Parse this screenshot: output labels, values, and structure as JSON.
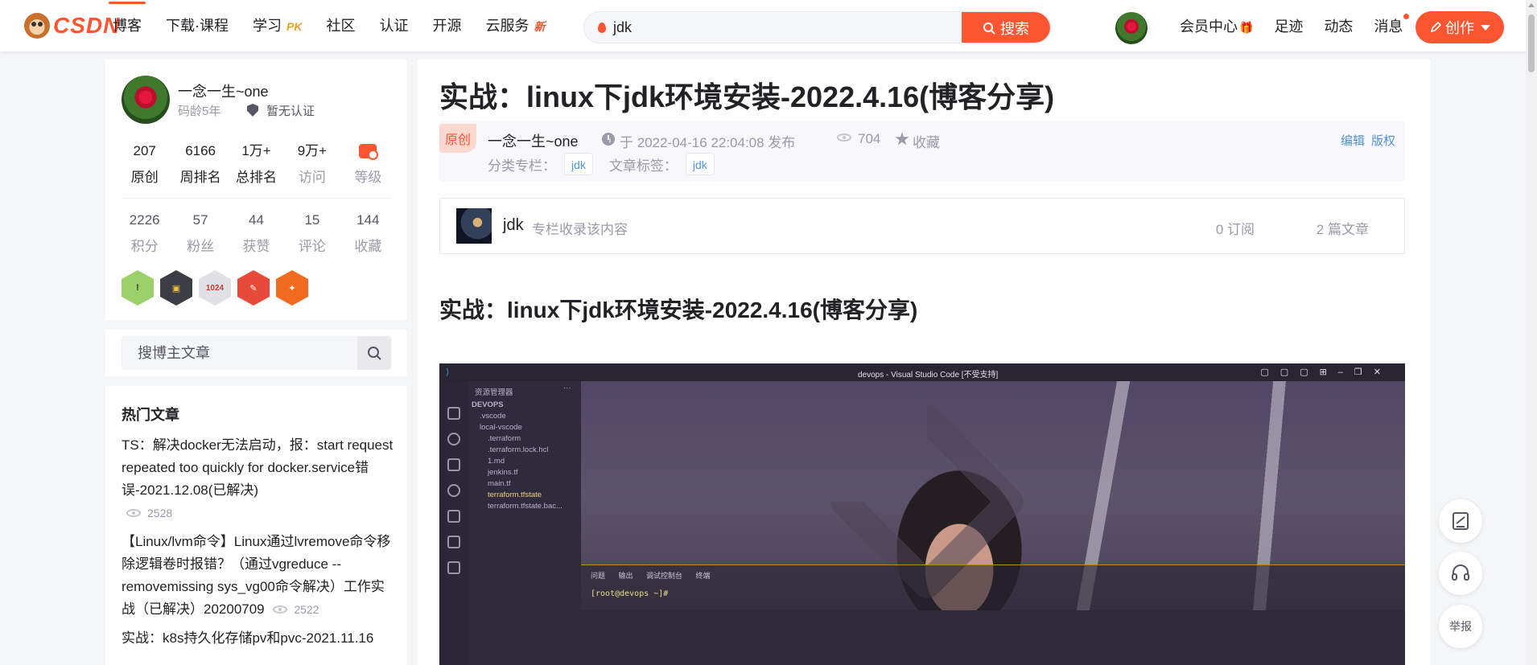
{
  "topnav": {
    "logo_text": "CSDN",
    "items": [
      {
        "label": "博客",
        "active": true,
        "badge": ""
      },
      {
        "label": "下载·课程",
        "active": false,
        "badge": ""
      },
      {
        "label": "学习",
        "active": false,
        "badge": "PK"
      },
      {
        "label": "社区",
        "active": false,
        "badge": ""
      },
      {
        "label": "认证",
        "active": false,
        "badge": ""
      },
      {
        "label": "开源",
        "active": false,
        "badge": ""
      },
      {
        "label": "云服务",
        "active": false,
        "badge": "新"
      }
    ],
    "search_query": "jdk",
    "search_button": "搜索",
    "right_links": {
      "member": "会员中心",
      "footprint": "足迹",
      "dynamics": "动态",
      "messages": "消息"
    },
    "create_button": "创作",
    "accent_color": "#fc5531"
  },
  "profile": {
    "name": "一念一生~one",
    "age": "码龄5年",
    "cert": "暂无认证",
    "stats_row1": [
      {
        "value": "207",
        "label": "原创"
      },
      {
        "value": "6166",
        "label": "周排名"
      },
      {
        "value": "1万+",
        "label": "总排名"
      },
      {
        "value": "9万+",
        "label": "访问"
      },
      {
        "value": "",
        "label": "等级"
      }
    ],
    "stats_row2": [
      {
        "value": "2226",
        "label": "积分"
      },
      {
        "value": "57",
        "label": "粉丝"
      },
      {
        "value": "44",
        "label": "获赞"
      },
      {
        "value": "15",
        "label": "评论"
      },
      {
        "value": "144",
        "label": "收藏"
      }
    ],
    "badges": [
      {
        "icon": "check-in-badge-icon",
        "text": "!",
        "color": "#9bd06a"
      },
      {
        "icon": "blog-badge-icon",
        "text": "",
        "color": "#3d3d45"
      },
      {
        "icon": "1024-badge-icon",
        "text": "1024",
        "color": "#e0e0e6"
      },
      {
        "icon": "pen-badge-icon",
        "text": "",
        "color": "#e84a3a"
      },
      {
        "icon": "gift-badge-icon",
        "text": "",
        "color": "#f06a20"
      }
    ]
  },
  "side_search": {
    "placeholder": "搜博主文章"
  },
  "hot": {
    "title": "热门文章",
    "items": [
      {
        "title": "TS：解决docker无法启动，报：start request repeated too quickly for docker.service错误-2021.12.08(已解决)",
        "views": "2528"
      },
      {
        "title": "【Linux/lvm命令】Linux通过lvremove命令移除逻辑卷时报错？（通过vgreduce --removemissing sys_vg00命令解决）工作实战（已解决）20200709",
        "views": "2522"
      },
      {
        "title": "实战：k8s持久化存储pv和pvc-2021.11.16",
        "views": ""
      }
    ]
  },
  "article": {
    "title": "实战：linux下jdk环境安装-2022.4.16(博客分享)",
    "original_tag": "原创",
    "author": "一念一生~one",
    "time": "于 2022-04-16 22:04:08 发布",
    "views": "704",
    "favorite": "收藏",
    "edit": "编辑",
    "copyright": "版权",
    "category_label": "分类专栏：",
    "category": "jdk",
    "tags_label": "文章标签：",
    "tag": "jdk",
    "column": {
      "name": "jdk",
      "desc": "专栏收录该内容",
      "subs": "0 订阅",
      "count": "2 篇文章"
    },
    "heading": "实战：linux下jdk环境安装-2022.4.16(博客分享)"
  },
  "screenshot": {
    "window_title": "devops - Visual Studio Code [不受支持]",
    "explorer_title": "资源管理器",
    "root": "DEVOPS",
    "tree": [
      ".vscode",
      "local-vscode",
      ".terraform",
      ".terraform.lock.hcl",
      "1.md",
      "jenkins.tf",
      "main.tf",
      "terraform.tfstate",
      "terraform.tfstate.bac..."
    ],
    "terminal_tabs": "问题 输出 调试控制台 终端",
    "terminal_prompt": "[root@devops ~]#"
  },
  "float_tools": {
    "report": "举报"
  }
}
